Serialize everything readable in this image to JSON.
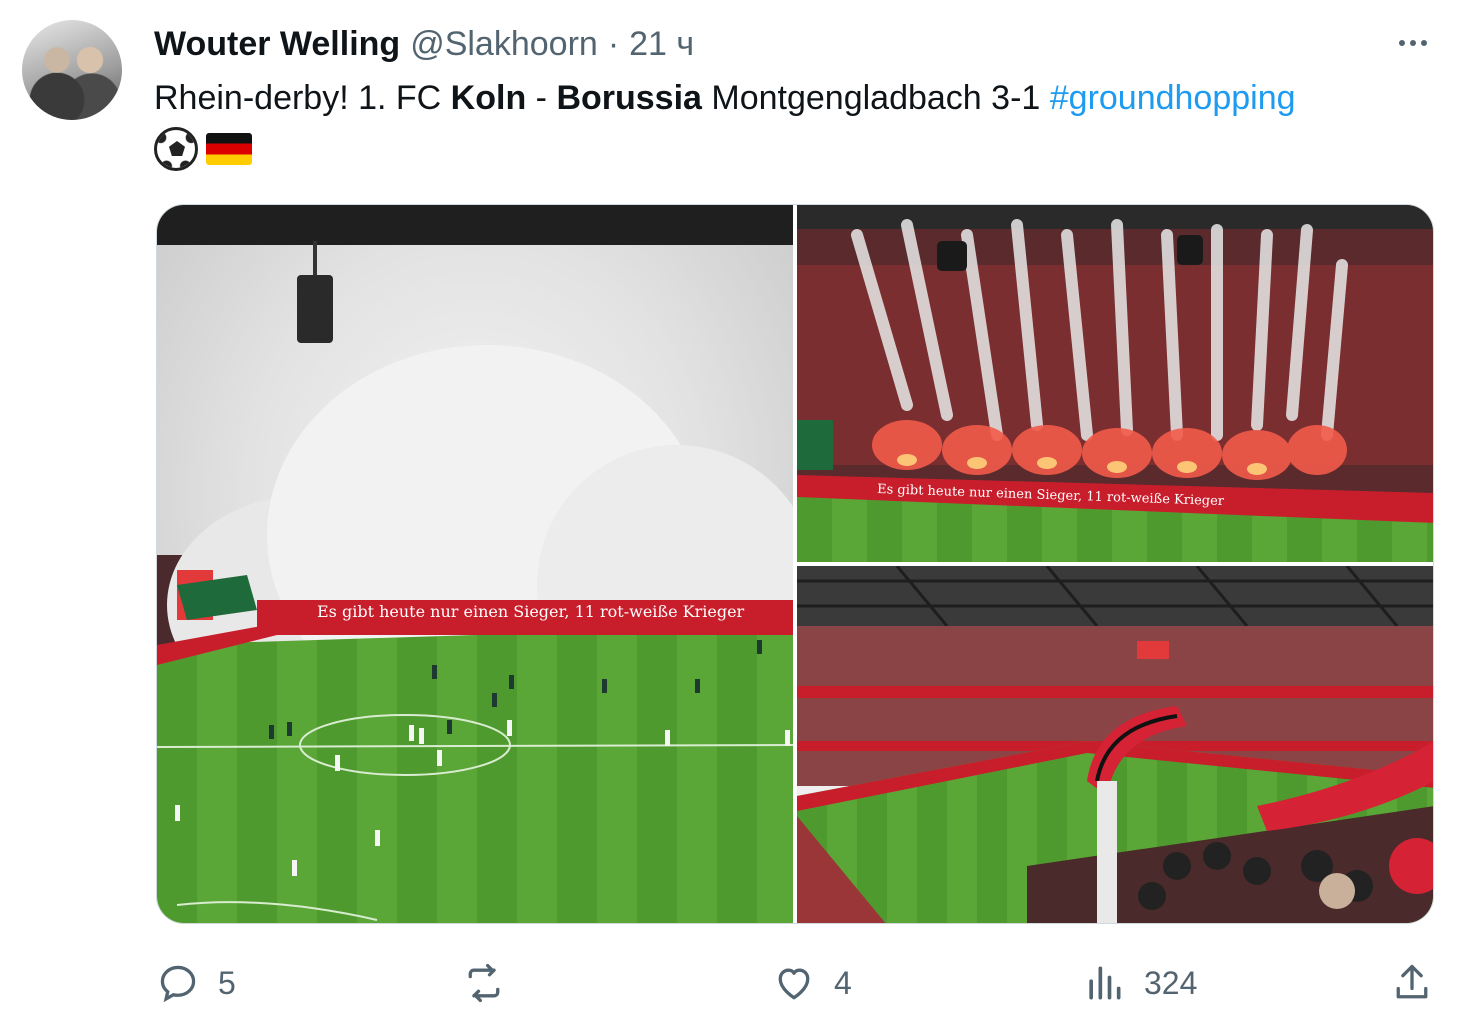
{
  "tweet": {
    "display_name": "Wouter Welling",
    "handle": "@Slakhoorn",
    "separator": "·",
    "time": "21 ч",
    "text_part1": "Rhein-derby! 1. FC ",
    "text_bold1": "Koln",
    "text_part2": " - ",
    "text_bold2": "Borussia",
    "text_part3": " Montgengladbach 3-1 ",
    "hashtag": "#groundhopping",
    "emojis": [
      "soccer-ball",
      "germany-flag"
    ]
  },
  "media": {
    "banner_text": "Es gibt heute nur einen Sieger, 11 rot-weiße Krieger"
  },
  "actions": {
    "replies": "5",
    "retweets": "",
    "likes": "4",
    "views": "324"
  },
  "colors": {
    "text": "#0f1419",
    "secondary": "#536471",
    "link": "#1d9bf0",
    "pitch": "#4f9a2e",
    "smoke_red": "#e23a3a"
  }
}
